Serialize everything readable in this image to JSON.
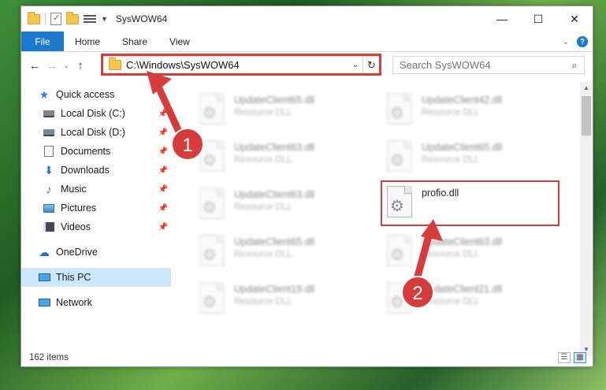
{
  "window": {
    "title": "SysWOW64",
    "controls": {
      "minimize": "—",
      "maximize": "☐",
      "close": "✕"
    }
  },
  "ribbon": {
    "tabs": [
      "File",
      "Home",
      "Share",
      "View"
    ],
    "expand": "⌄",
    "help": "?"
  },
  "nav": {
    "back": "←",
    "forward": "→",
    "recent": "⌄",
    "up": "↑",
    "address": "C:\\Windows\\SysWOW64",
    "address_drop": "⌄",
    "refresh": "↻",
    "search_placeholder": "Search SysWOW64",
    "search_icon": "⌕"
  },
  "sidebar": {
    "quick_access": "Quick access",
    "pinned": [
      {
        "label": "Local Disk (C:)",
        "icon": "disk-icon"
      },
      {
        "label": "Local Disk (D:)",
        "icon": "disk-icon"
      },
      {
        "label": "Documents",
        "icon": "documents-icon"
      },
      {
        "label": "Downloads",
        "icon": "downloads-icon"
      },
      {
        "label": "Music",
        "icon": "music-icon"
      },
      {
        "label": "Pictures",
        "icon": "pictures-icon"
      },
      {
        "label": "Videos",
        "icon": "videos-icon"
      }
    ],
    "onedrive": "OneDrive",
    "this_pc": "This PC",
    "network": "Network"
  },
  "files": [
    {
      "name": "UpdateClient65.dll",
      "type": "Resource DLL"
    },
    {
      "name": "UpdateClient42.dll",
      "type": "Resource DLL"
    },
    {
      "name": "UpdateClient63.dll",
      "type": "Resource DLL"
    },
    {
      "name": "UpdateClient65.dll",
      "type": "Resource DLL"
    },
    {
      "name": "UpdateClient63.dll",
      "type": "Resource DLL"
    },
    {
      "name": "profio.dll",
      "type": ""
    },
    {
      "name": "UpdateClient65.dll",
      "type": "Resource DLL"
    },
    {
      "name": "UpdateClient63.dll",
      "type": "Resource DLL"
    },
    {
      "name": "UpdateClient19.dll",
      "type": "Resource DLL"
    },
    {
      "name": "UpdateClient21.dll",
      "type": "Resource DLL"
    }
  ],
  "status": {
    "item_count": "162 items"
  },
  "annotations": {
    "step1": "1",
    "step2": "2",
    "color": "#d83b3b"
  }
}
